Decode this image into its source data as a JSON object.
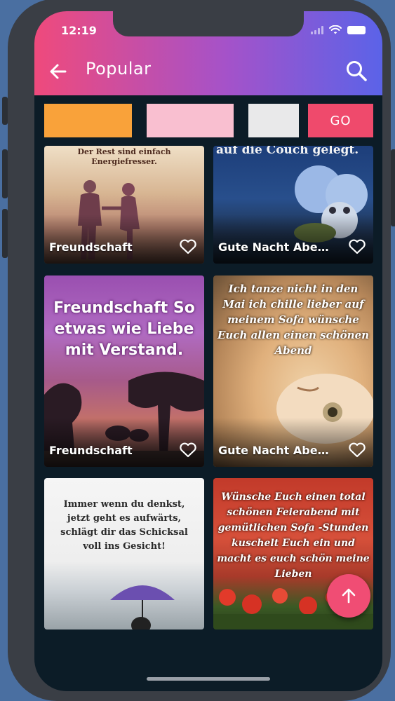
{
  "status_bar": {
    "time": "12:19"
  },
  "header": {
    "title": "Popular"
  },
  "filters": {
    "swatches": [
      {
        "name": "orange",
        "color": "#f9a23a"
      },
      {
        "name": "pink",
        "color": "#f9bfd0"
      },
      {
        "name": "white",
        "color": "#e9e9ea"
      }
    ],
    "go_label": "GO"
  },
  "cards": [
    {
      "title": "Freundschaft",
      "caption": "Der Rest sind einfach Energiefresser."
    },
    {
      "title": "Gute Nacht Abe…",
      "caption": "auf die Couch gelegt."
    },
    {
      "title": "Freundschaft",
      "caption": "Freundschaft So etwas wie Liebe mit Verstand."
    },
    {
      "title": "Gute Nacht Abe…",
      "caption": "Ich tanze nicht in den Mai ich chille lieber auf meinem Sofa wünsche Euch allen einen schönen Abend"
    },
    {
      "title": "",
      "caption": "Immer wenn du denkst, jetzt geht es aufwärts, schlägt dir das Schicksal voll ins Gesicht!"
    },
    {
      "title": "",
      "caption": "Wünsche Euch einen total schönen Feierabend mit gemütlichen Sofa -Stunden kuschelt Euch ein und macht es euch schön meine Lieben"
    }
  ],
  "colors": {
    "header_gradient": [
      "#ef4a7c",
      "#a552c9",
      "#5b63e8"
    ],
    "go_button": "#ef4a6c",
    "fab": "#f04d74",
    "background": "#0c1c27"
  },
  "icons": {
    "back": "arrow-left-icon",
    "search": "search-icon",
    "favorite": "heart-outline-icon",
    "scroll_top": "arrow-up-icon"
  }
}
